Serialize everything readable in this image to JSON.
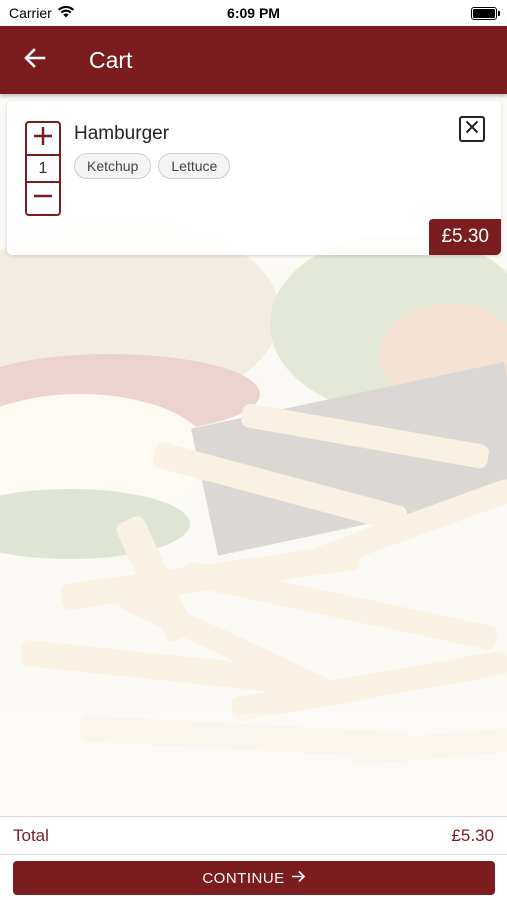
{
  "status_bar": {
    "carrier": "Carrier",
    "time": "6:09 PM"
  },
  "header": {
    "title": "Cart",
    "back_icon": "arrow-left-icon"
  },
  "cart": {
    "items": [
      {
        "name": "Hamburger",
        "quantity": "1",
        "options": [
          "Ketchup",
          "Lettuce"
        ],
        "price": "£5.30"
      }
    ]
  },
  "footer": {
    "total_label": "Total",
    "total_value": "£5.30",
    "continue_label": "CONTINUE"
  },
  "colors": {
    "brand": "#7b1c1e",
    "background": "#ffffff"
  }
}
